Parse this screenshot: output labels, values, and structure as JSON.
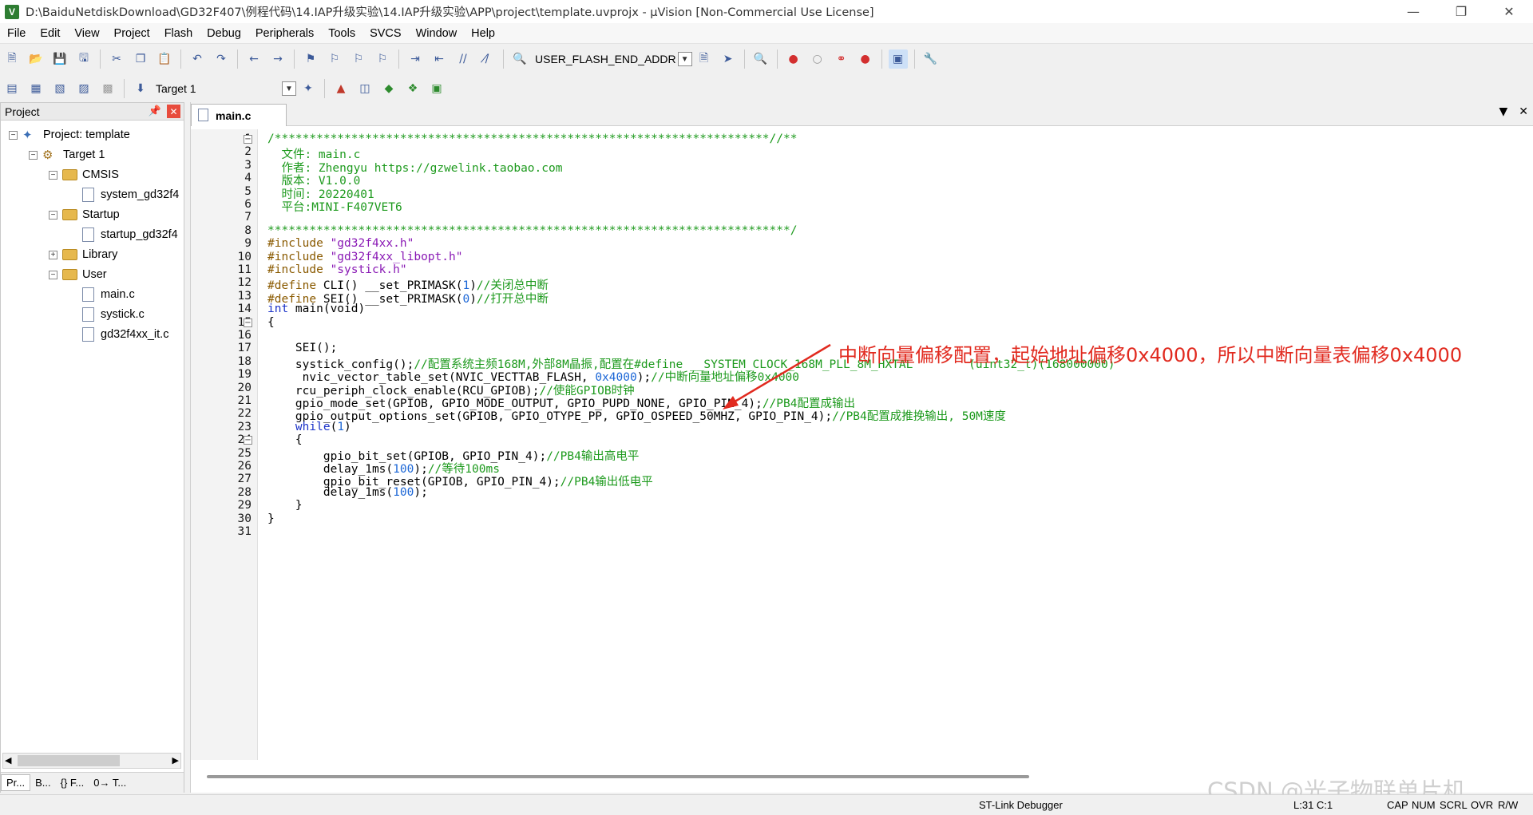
{
  "window": {
    "title": "D:\\BaiduNetdiskDownload\\GD32F407\\例程代码\\14.IAP升级实验\\14.IAP升级实验\\APP\\project\\template.uvprojx - µVision  [Non-Commercial Use License]",
    "app_icon_letter": "V"
  },
  "menu": [
    "File",
    "Edit",
    "View",
    "Project",
    "Flash",
    "Debug",
    "Peripherals",
    "Tools",
    "SVCS",
    "Window",
    "Help"
  ],
  "toolbar": {
    "find_combo_value": "USER_FLASH_END_ADDR",
    "target_combo_value": "Target 1"
  },
  "project_panel": {
    "title": "Project",
    "tree": [
      {
        "label": "Project: template",
        "kind": "project",
        "level": 0,
        "expander": "−"
      },
      {
        "label": "Target 1",
        "kind": "target",
        "level": 1,
        "expander": "−"
      },
      {
        "label": "CMSIS",
        "kind": "folder",
        "level": 2,
        "expander": "−"
      },
      {
        "label": "system_gd32f4",
        "kind": "file",
        "level": 3,
        "expander": ""
      },
      {
        "label": "Startup",
        "kind": "folder",
        "level": 2,
        "expander": "−"
      },
      {
        "label": "startup_gd32f4",
        "kind": "file",
        "level": 3,
        "expander": ""
      },
      {
        "label": "Library",
        "kind": "folder",
        "level": 2,
        "expander": "+"
      },
      {
        "label": "User",
        "kind": "folder",
        "level": 2,
        "expander": "−"
      },
      {
        "label": "main.c",
        "kind": "file",
        "level": 3,
        "expander": ""
      },
      {
        "label": "systick.c",
        "kind": "file",
        "level": 3,
        "expander": ""
      },
      {
        "label": "gd32f4xx_it.c",
        "kind": "file",
        "level": 3,
        "expander": ""
      }
    ],
    "tabs": [
      "Pr...",
      "B...",
      "{} F...",
      "0→ T..."
    ]
  },
  "editor": {
    "active_tab": "main.c",
    "lines": [
      {
        "n": "1",
        "fold": "−",
        "segs": [
          [
            "c-comment",
            "/***********************************************************************//**"
          ]
        ]
      },
      {
        "n": "2",
        "segs": [
          [
            "c-comment",
            "  文件: main.c"
          ]
        ]
      },
      {
        "n": "3",
        "segs": [
          [
            "c-comment",
            "  作者: Zhengyu https://gzwelink.taobao.com"
          ]
        ]
      },
      {
        "n": "4",
        "segs": [
          [
            "c-comment",
            "  版本: V1.0.0"
          ]
        ]
      },
      {
        "n": "5",
        "segs": [
          [
            "c-comment",
            "  时间: 20220401"
          ]
        ]
      },
      {
        "n": "6",
        "segs": [
          [
            "c-comment",
            "  平台:MINI-F407VET6"
          ]
        ]
      },
      {
        "n": "7",
        "segs": []
      },
      {
        "n": "8",
        "segs": [
          [
            "c-comment",
            "***************************************************************************/"
          ]
        ]
      },
      {
        "n": "9",
        "segs": [
          [
            "c-pp",
            "#include "
          ],
          [
            "c-str",
            "\"gd32f4xx.h\""
          ]
        ]
      },
      {
        "n": "10",
        "segs": [
          [
            "c-pp",
            "#include "
          ],
          [
            "c-str",
            "\"gd32f4xx_libopt.h\""
          ]
        ]
      },
      {
        "n": "11",
        "segs": [
          [
            "c-pp",
            "#include "
          ],
          [
            "c-str",
            "\"systick.h\""
          ]
        ]
      },
      {
        "n": "12",
        "segs": [
          [
            "c-pp",
            "#define "
          ],
          [
            "c-def",
            "CLI() __set_PRIMASK("
          ],
          [
            "c-num",
            "1"
          ],
          [
            "c-def",
            ")"
          ],
          [
            "c-comment",
            "//关闭总中断"
          ]
        ]
      },
      {
        "n": "13",
        "segs": [
          [
            "c-pp",
            "#define "
          ],
          [
            "c-def",
            "SEI() __set_PRIMASK("
          ],
          [
            "c-num",
            "0"
          ],
          [
            "c-def",
            ")"
          ],
          [
            "c-comment",
            "//打开总中断"
          ]
        ]
      },
      {
        "n": "14",
        "segs": [
          [
            "c-kw",
            "int"
          ],
          [
            "c-def",
            " main(void)"
          ]
        ]
      },
      {
        "n": "15",
        "fold": "−",
        "segs": [
          [
            "c-def",
            "{"
          ]
        ]
      },
      {
        "n": "16",
        "segs": []
      },
      {
        "n": "17",
        "segs": [
          [
            "c-def",
            "    SEI();"
          ]
        ]
      },
      {
        "n": "18",
        "segs": [
          [
            "c-def",
            "    systick_config();"
          ],
          [
            "c-comment",
            "//配置系统主频168M,外部8M晶振,配置在#define __SYSTEM_CLOCK_168M_PLL_8M_HXTAL        (uint32_t)(168000000)"
          ]
        ]
      },
      {
        "n": "19",
        "segs": [
          [
            "c-def",
            "     nvic_vector_table_set(NVIC_VECTTAB_FLASH, "
          ],
          [
            "c-num",
            "0x4000"
          ],
          [
            "c-def",
            ");"
          ],
          [
            "c-comment",
            "//中断向量地址偏移0x4000"
          ]
        ]
      },
      {
        "n": "20",
        "segs": [
          [
            "c-def",
            "    rcu_periph_clock_enable(RCU_GPIOB);"
          ],
          [
            "c-comment",
            "//使能GPIOB时钟"
          ]
        ]
      },
      {
        "n": "21",
        "segs": [
          [
            "c-def",
            "    gpio_mode_set(GPIOB, GPIO_MODE_OUTPUT, GPIO_PUPD_NONE, GPIO_PIN_4);"
          ],
          [
            "c-comment",
            "//PB4配置成输出"
          ]
        ]
      },
      {
        "n": "22",
        "segs": [
          [
            "c-def",
            "    gpio_output_options_set(GPIOB, GPIO_OTYPE_PP, GPIO_OSPEED_50MHZ, GPIO_PIN_4);"
          ],
          [
            "c-comment",
            "//PB4配置成推挽输出, 50M速度"
          ]
        ]
      },
      {
        "n": "23",
        "segs": [
          [
            "c-kw",
            "    while"
          ],
          [
            "c-def",
            "("
          ],
          [
            "c-num",
            "1"
          ],
          [
            "c-def",
            ")"
          ]
        ]
      },
      {
        "n": "24",
        "fold": "−",
        "segs": [
          [
            "c-def",
            "    {"
          ]
        ]
      },
      {
        "n": "25",
        "segs": [
          [
            "c-def",
            "        gpio_bit_set(GPIOB, GPIO_PIN_4);"
          ],
          [
            "c-comment",
            "//PB4输出高电平"
          ]
        ]
      },
      {
        "n": "26",
        "segs": [
          [
            "c-def",
            "        delay_1ms("
          ],
          [
            "c-num",
            "100"
          ],
          [
            "c-def",
            ");"
          ],
          [
            "c-comment",
            "//等待100ms"
          ]
        ]
      },
      {
        "n": "27",
        "segs": [
          [
            "c-def",
            "        gpio_bit_reset(GPIOB, GPIO_PIN_4);"
          ],
          [
            "c-comment",
            "//PB4输出低电平"
          ]
        ]
      },
      {
        "n": "28",
        "segs": [
          [
            "c-def",
            "        delay_1ms("
          ],
          [
            "c-num",
            "100"
          ],
          [
            "c-def",
            ");"
          ]
        ]
      },
      {
        "n": "29",
        "segs": [
          [
            "c-def",
            "    }"
          ]
        ]
      },
      {
        "n": "30",
        "segs": [
          [
            "c-def",
            "}"
          ]
        ]
      },
      {
        "n": "31",
        "segs": []
      }
    ]
  },
  "annotation": {
    "text": "中断向量偏移配置，起始地址偏移0x4000，所以中断向量表偏移0x4000",
    "color": "#e12a1f"
  },
  "statusbar": {
    "debugger": "ST-Link Debugger",
    "position": "L:31 C:1",
    "indicators": [
      "CAP",
      "NUM",
      "SCRL",
      "OVR",
      "R/W"
    ]
  },
  "watermark": "CSDN @光子物联单片机"
}
